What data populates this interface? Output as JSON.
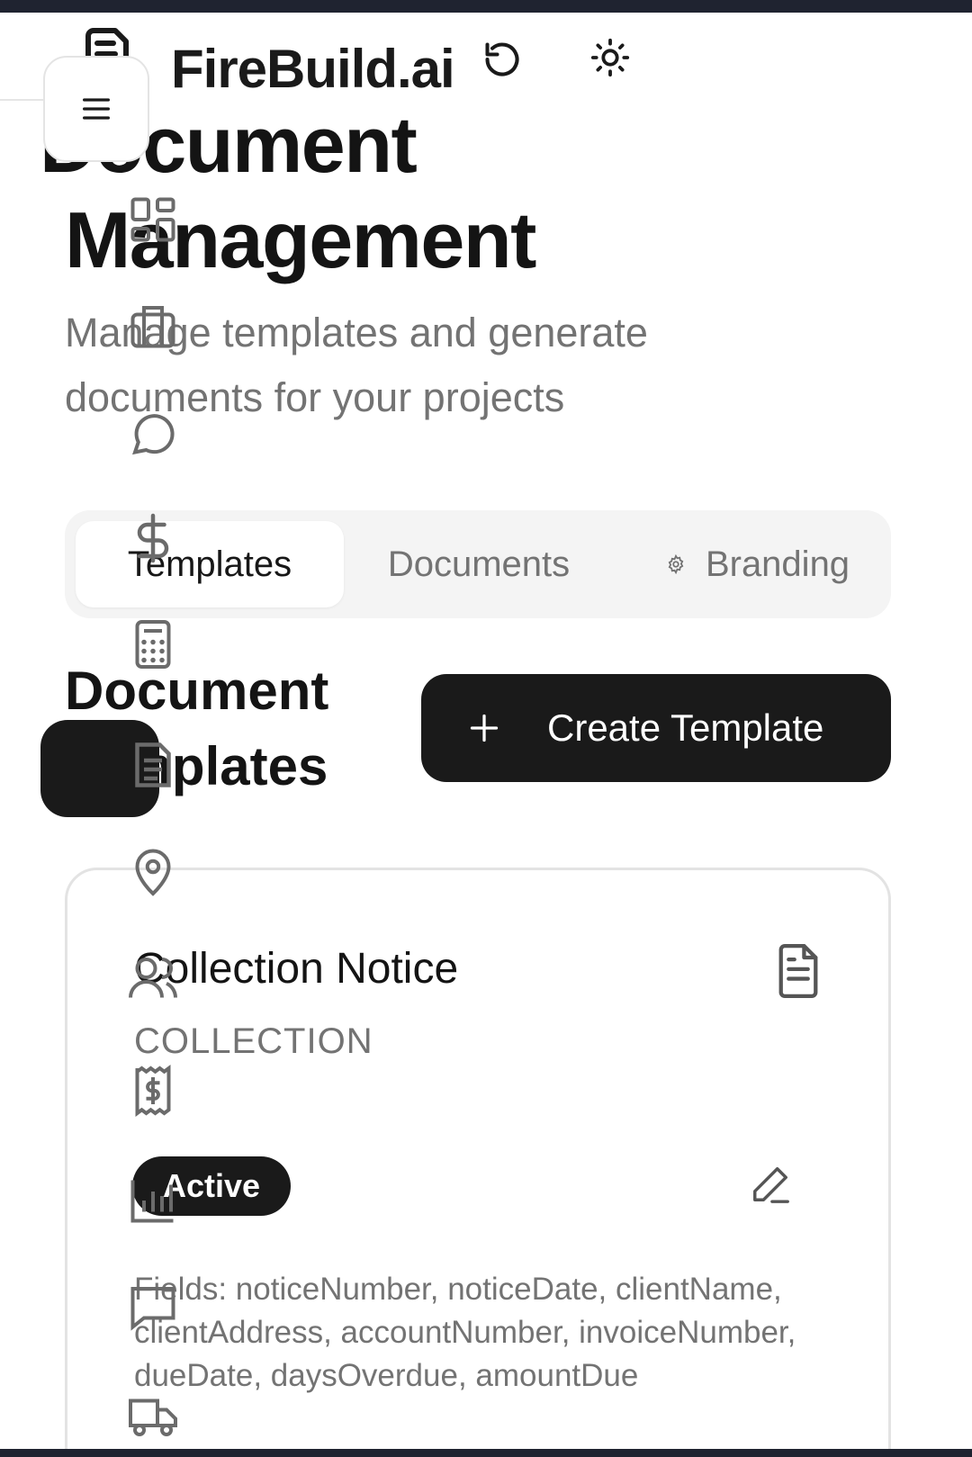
{
  "app": {
    "name": "FireBuild.ai",
    "icons": {
      "brand": "file-text-icon",
      "refresh": "refresh-icon",
      "theme": "sun-icon",
      "menu": "menu-icon"
    }
  },
  "page": {
    "title": "Document Management",
    "subtitle": "Manage templates and generate documents for your projects"
  },
  "tabs": [
    {
      "label": "Templates",
      "active": true
    },
    {
      "label": "Documents",
      "active": false
    },
    {
      "label": "Branding",
      "active": false,
      "icon": "gear-icon"
    }
  ],
  "section": {
    "title": "Document Templates",
    "create_label": "Create Template"
  },
  "template_card": {
    "title": "Collection Notice",
    "category": "COLLECTION",
    "status": "Active",
    "fields_text": "Fields: noticeNumber, noticeDate, clientName, clientAddress, accountNumber, invoiceNumber, dueDate, daysOverdue, amountDue"
  },
  "sidebar": {
    "icons": [
      "dashboard-icon",
      "briefcase-icon",
      "message-icon",
      "dollar-icon",
      "calculator-icon",
      "documents-icon",
      "map-pin-icon",
      "users-icon",
      "receipt-icon",
      "chart-icon",
      "chat-icon",
      "truck-icon"
    ],
    "active_icon": "documents-icon"
  },
  "colors": {
    "primary": "#1a1a1a",
    "muted_text": "#737373",
    "tab_bg": "#f4f4f4",
    "border": "#e3e3e3",
    "frame": "#1f2330"
  }
}
